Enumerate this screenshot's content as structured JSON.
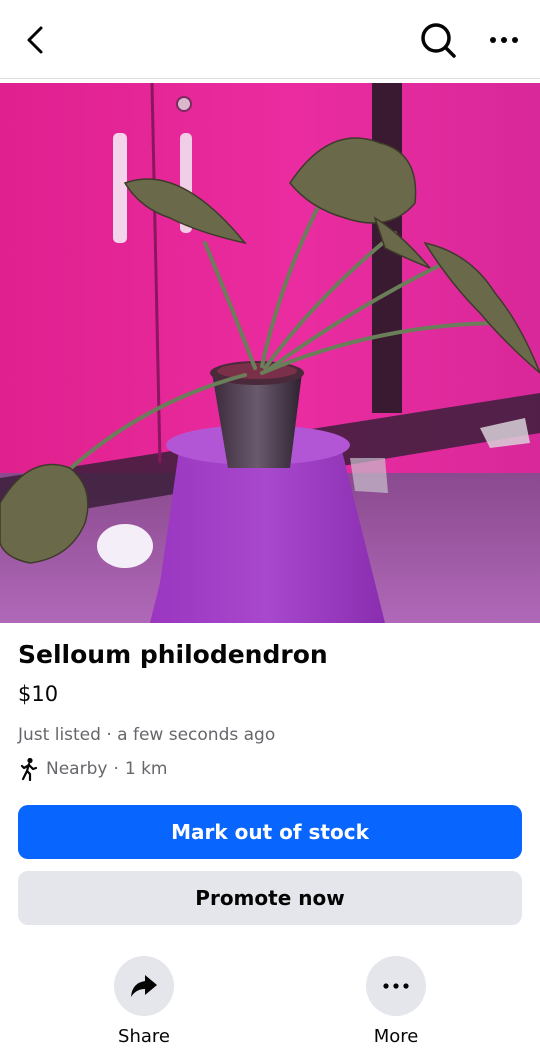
{
  "header": {
    "back_icon": "chevron-left-icon",
    "search_icon": "search-icon",
    "more_icon": "more-horizontal-icon"
  },
  "listing": {
    "photo_subject": "plant-photo",
    "title": "Selloum philodendron",
    "price": "$10",
    "listed_status": "Just listed",
    "listed_time": "a few seconds ago",
    "distance_label": "Nearby",
    "distance_value": "1 km"
  },
  "buttons": {
    "mark_out_of_stock": "Mark out of stock",
    "promote_now": "Promote now"
  },
  "actions": {
    "share": "Share",
    "more": "More"
  },
  "colors": {
    "primary": "#0866ff",
    "secondary_bg": "#e4e6eb",
    "muted_text": "#65676b"
  }
}
